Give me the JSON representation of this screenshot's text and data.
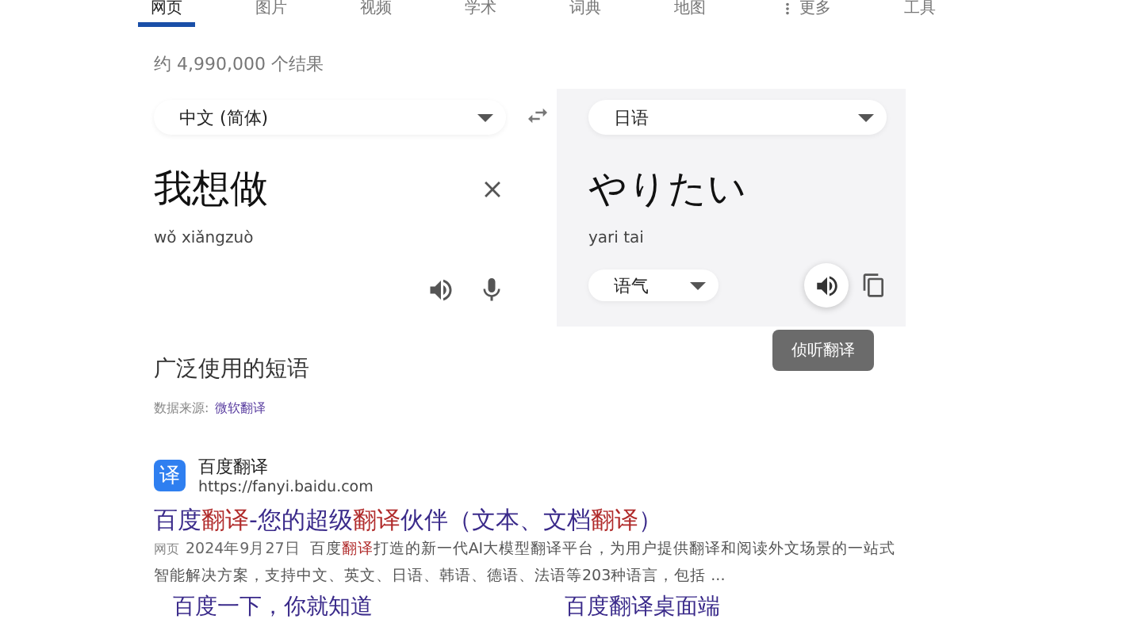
{
  "tabs": [
    {
      "label": "网页",
      "selected": true
    },
    {
      "label": "图片",
      "selected": false
    },
    {
      "label": "视频",
      "selected": false
    },
    {
      "label": "学术",
      "selected": false
    },
    {
      "label": "词典",
      "selected": false
    },
    {
      "label": "地图",
      "selected": false
    },
    {
      "label": "更多",
      "selected": false
    },
    {
      "label": "工具",
      "selected": false
    }
  ],
  "result_count": "约 4,990,000 个结果",
  "translator": {
    "source_language": "中文 (简体)",
    "target_language": "日语",
    "source_text": "我想做",
    "source_pinyin": "wǒ xiǎngzuò",
    "target_text": "やりたい",
    "target_romanization": "yari tai",
    "tone_select": "语气",
    "listen_hovered": true,
    "tooltip": "侦听翻译"
  },
  "phrases": {
    "title": "广泛使用的短语",
    "source_label": "数据来源:",
    "source_link": "微软翻译"
  },
  "result": {
    "favicon": "译",
    "site_name": "百度翻译",
    "url": "https://fanyi.baidu.com",
    "title": "百度**翻译**-您的超级**翻译**伙伴（文本、文档**翻译**）",
    "tag": "网页",
    "date": "2024年9月27日",
    "snippet": "百度**翻译**打造的新一代AI大模型翻译平台，为用户提供翻译和阅读外文场景的一站式智能解决方案，支持中文、英文、日语、韩语、德语、法语等203种语言，包括 ...",
    "sitelinks": [
      "百度一下，你就知道",
      "百度翻译桌面端"
    ]
  }
}
